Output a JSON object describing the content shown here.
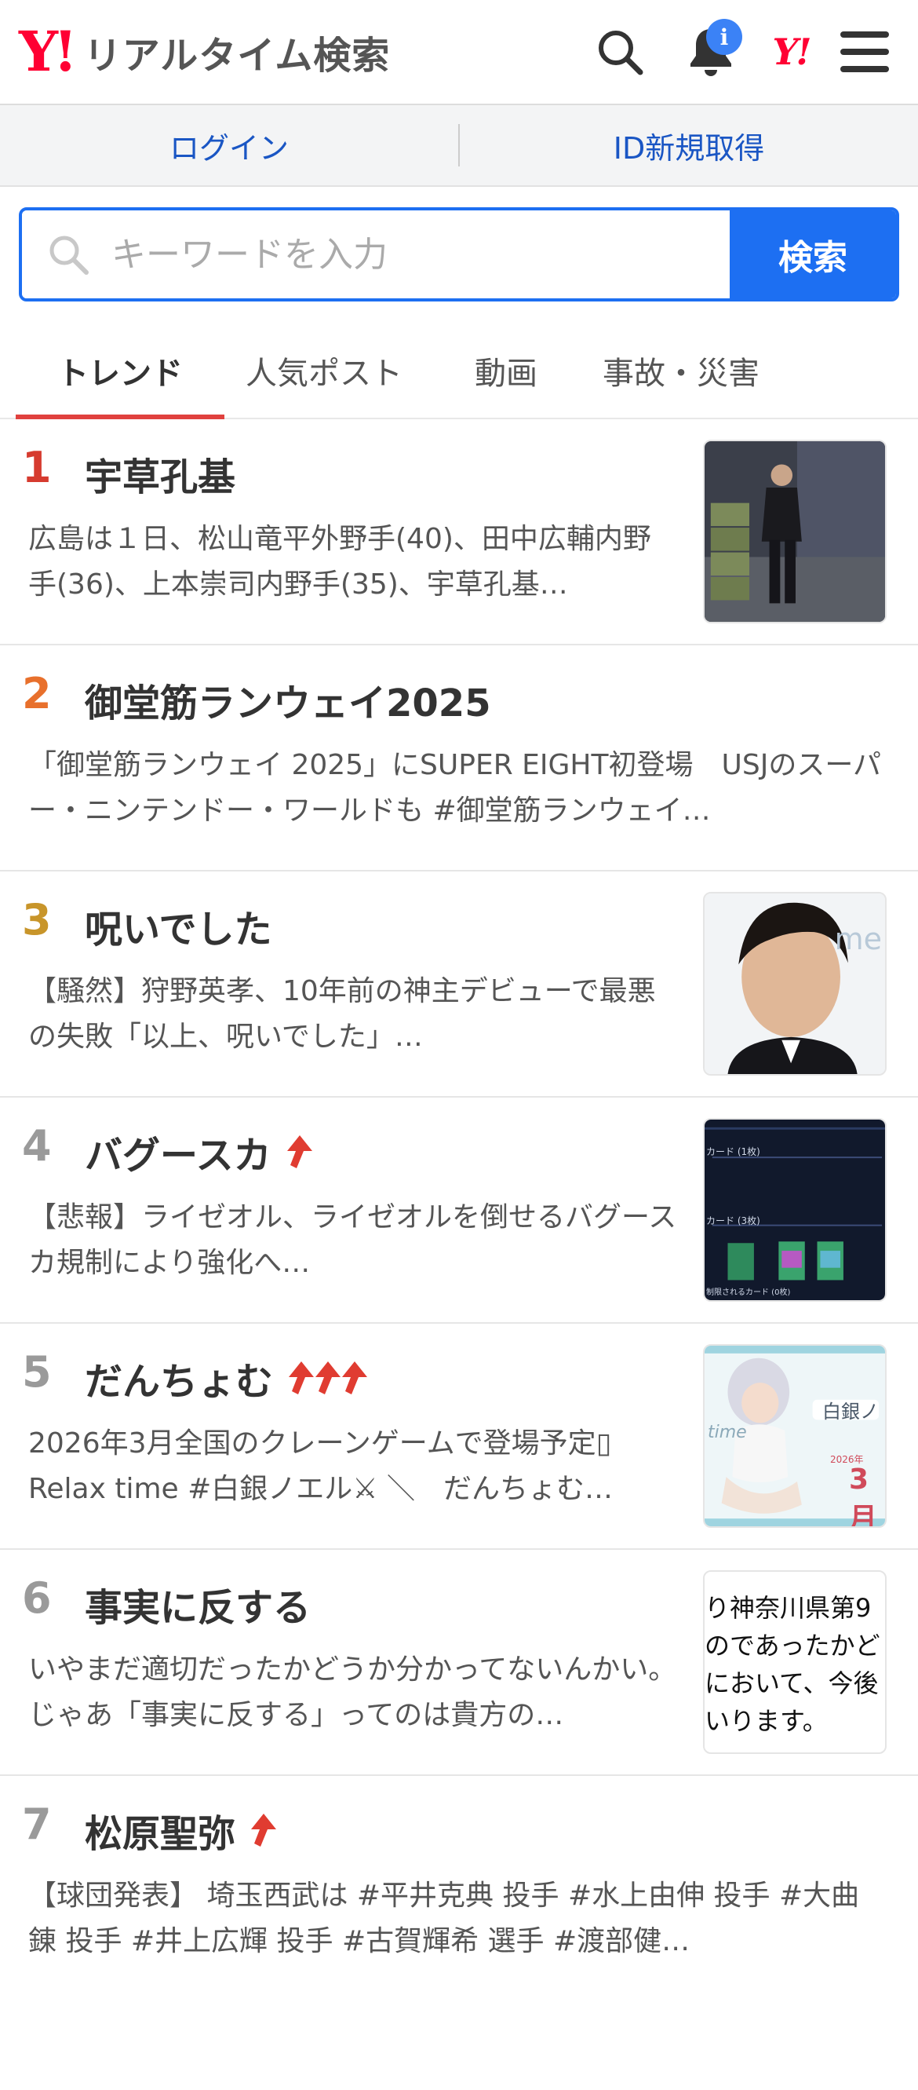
{
  "header": {
    "logo_mark": "Y!",
    "logo_text": "リアルタイム検索",
    "notification_badge": "i",
    "yj_mark": "Y!"
  },
  "auth": {
    "login": "ログイン",
    "register": "ID新規取得"
  },
  "search": {
    "placeholder": "キーワードを入力",
    "button": "検索"
  },
  "tabs": [
    {
      "label": "トレンド",
      "active": true
    },
    {
      "label": "人気ポスト"
    },
    {
      "label": "動画"
    },
    {
      "label": "事故・災害"
    }
  ],
  "colors": {
    "rank1": "#d63b2f",
    "rank2": "#e8702c",
    "rank3": "#c8952a",
    "rank_other": "#9a9a9a",
    "accent": "#1d6ff2",
    "arrow": "#e03c31"
  },
  "trends": [
    {
      "rank": "1",
      "title": "宇草孔基",
      "desc": "広島は１日、松山竜平外野手(40)、田中広輔内野手(36)、上本崇司内野手(35)、宇草孔基…",
      "thumb": "photo-man-suit-corridor"
    },
    {
      "rank": "2",
      "title": "御堂筋ランウェイ2025",
      "desc": "「御堂筋ランウェイ 2025」にSUPER EIGHT初登場　USJのスーパー・ニンテンドー・ワールドも #御堂筋ランウェイ…"
    },
    {
      "rank": "3",
      "title": "呪いでした",
      "desc": "【騒然】狩野英孝、10年前の神主デビューで最悪の失敗「以上、呪いでした」…",
      "thumb": "photo-portrait-man",
      "thumb_text": "me"
    },
    {
      "rank": "4",
      "title": "バグースカ",
      "arrows": 1,
      "desc": "【悲報】ライゼオル、ライゼオルを倒せるバグースカ規制により強化へ…",
      "thumb": "screenshot-card-game",
      "thumb_labels": [
        "カード (1枚)",
        "カード (3枚)",
        "制限されるカード (0枚)"
      ]
    },
    {
      "rank": "5",
      "title": "だんちょむ",
      "arrows": 3,
      "desc": "2026年3月全国のクレーンゲームで登場予定▯ Relax time #白銀ノエル⚔ ＼　だんちょむ…",
      "thumb": "figure-promo-image",
      "thumb_labels": [
        "白銀ノ",
        "2026年",
        "3月",
        "time"
      ]
    },
    {
      "rank": "6",
      "title": "事実に反する",
      "desc": "いやまだ適切だったかどうか分かってないんかい。じゃあ「事実に反する」ってのは貴方の…",
      "thumb": "text-document-image",
      "thumb_lines": [
        "り神奈川県第9",
        "のであったかど",
        "において、今後",
        "いります。"
      ]
    },
    {
      "rank": "7",
      "title": "松原聖弥",
      "arrows": 1,
      "desc": "【球団発表】 埼玉西武は #平井克典 投手 #水上由伸 投手 #大曲錬 投手 #井上広輝 投手 #古賀輝希 選手 #渡部健…"
    }
  ]
}
